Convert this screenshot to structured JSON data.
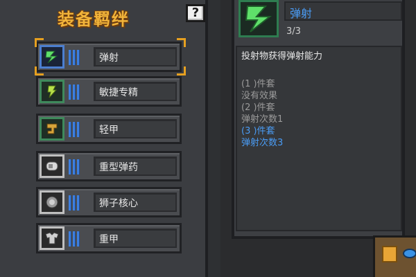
{
  "panel": {
    "title": "装备羁绊",
    "help_label": "?"
  },
  "bonds": [
    {
      "name": "弹射",
      "icon": "ricochet-bolt-icon",
      "frame_color": "#4c7fd0",
      "selected": true
    },
    {
      "name": "敏捷专精",
      "icon": "agility-feather-icon",
      "frame_color": "#3f8a5c",
      "selected": false
    },
    {
      "name": "轻甲",
      "icon": "light-armor-icon",
      "frame_color": "#3f8a5c",
      "selected": false
    },
    {
      "name": "重型弹药",
      "icon": "heavy-ammo-icon",
      "frame_color": "#bfbfbf",
      "selected": false
    },
    {
      "name": "狮子核心",
      "icon": "lion-core-icon",
      "frame_color": "#bfbfbf",
      "selected": false
    },
    {
      "name": "重甲",
      "icon": "heavy-armor-icon",
      "frame_color": "#bfbfbf",
      "selected": false
    }
  ],
  "detail": {
    "name": "弹射",
    "count": "3/3",
    "description": "投射物获得弹射能力",
    "tiers": [
      {
        "req": "(1 )件套",
        "effect": "没有效果",
        "active": false
      },
      {
        "req": "(2 )件套",
        "effect": "弹射次数1",
        "active": false
      },
      {
        "req": "(3 )件套",
        "effect": "弹射次数3",
        "active": true
      }
    ]
  },
  "colors": {
    "title": "#f2b43a",
    "accent_blue": "#4a9cf5",
    "inactive_text": "#9a9a9a",
    "selection": "#e6a020"
  }
}
